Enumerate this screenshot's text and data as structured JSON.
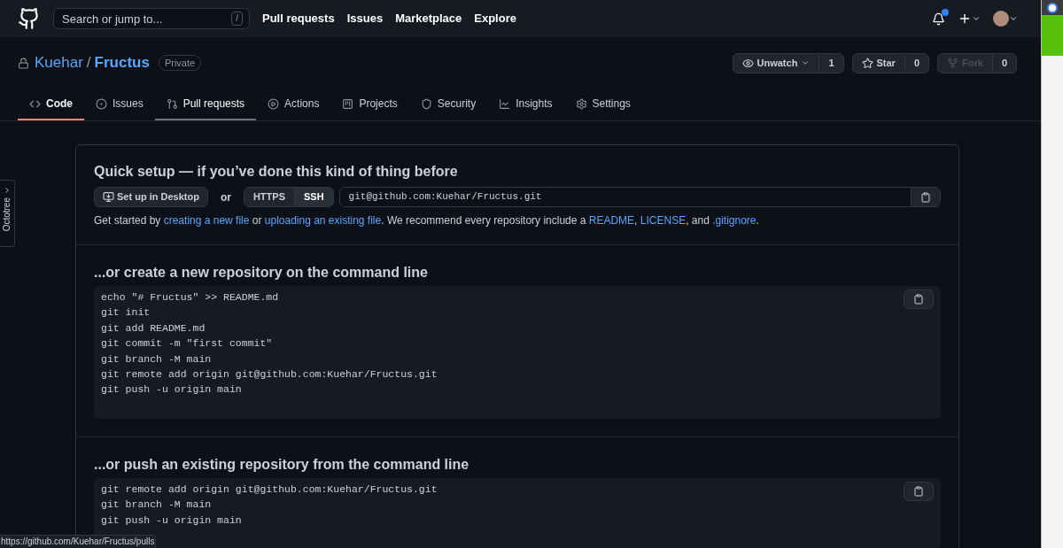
{
  "header": {
    "search": {
      "placeholder": "Search or jump to...",
      "shortcut": "/"
    },
    "nav": [
      "Pull requests",
      "Issues",
      "Marketplace",
      "Explore"
    ],
    "notification_unread": true
  },
  "repo": {
    "owner": "Kuehar",
    "separator": "/",
    "name": "Fructus",
    "visibility": "Private",
    "actions": [
      {
        "kind": "watch",
        "label": "Unwatch",
        "count": "1",
        "disabled": false
      },
      {
        "kind": "star",
        "label": "Star",
        "count": "0",
        "disabled": false
      },
      {
        "kind": "fork",
        "label": "Fork",
        "count": "0",
        "disabled": true
      }
    ]
  },
  "tabs": [
    {
      "kind": "code",
      "label": "Code",
      "selected": true,
      "hovered": false
    },
    {
      "kind": "issues",
      "label": "Issues",
      "selected": false,
      "hovered": false
    },
    {
      "kind": "pulls",
      "label": "Pull requests",
      "selected": false,
      "hovered": true
    },
    {
      "kind": "actions",
      "label": "Actions",
      "selected": false,
      "hovered": false
    },
    {
      "kind": "projects",
      "label": "Projects",
      "selected": false,
      "hovered": false
    },
    {
      "kind": "security",
      "label": "Security",
      "selected": false,
      "hovered": false
    },
    {
      "kind": "insights",
      "label": "Insights",
      "selected": false,
      "hovered": false
    },
    {
      "kind": "settings",
      "label": "Settings",
      "selected": false,
      "hovered": false
    }
  ],
  "sidebar_tab": {
    "label": "Octotree"
  },
  "quick_setup": {
    "title": "Quick setup — if you’ve done this kind of thing before",
    "desktop_button": "Set up in Desktop",
    "or": "or",
    "protocols": [
      {
        "label": "HTTPS",
        "selected": false
      },
      {
        "label": "SSH",
        "selected": true
      }
    ],
    "clone_url": "git@github.com:Kuehar/Fructus.git",
    "hint": [
      {
        "text": "Get started by ",
        "link": false
      },
      {
        "text": "creating a new file",
        "link": true
      },
      {
        "text": " or ",
        "link": false
      },
      {
        "text": "uploading an existing file",
        "link": true
      },
      {
        "text": ". We recommend every repository include a ",
        "link": false
      },
      {
        "text": "README",
        "link": true
      },
      {
        "text": ", ",
        "link": false
      },
      {
        "text": "LICENSE",
        "link": true
      },
      {
        "text": ", and ",
        "link": false
      },
      {
        "text": ".gitignore",
        "link": true
      },
      {
        "text": ".",
        "link": false
      }
    ]
  },
  "sections": [
    {
      "title": "...or create a new repository on the command line",
      "lines": [
        "echo \"# Fructus\" >> README.md",
        "git init",
        "git add README.md",
        "git commit -m \"first commit\"",
        "git branch -M main",
        "git remote add origin git@github.com:Kuehar/Fructus.git",
        "git push -u origin main"
      ]
    },
    {
      "title": "...or push an existing repository from the command line",
      "lines": [
        "git remote add origin git@github.com:Kuehar/Fructus.git",
        "git branch -M main",
        "git push -u origin main"
      ]
    }
  ],
  "status_bar": {
    "url": "https://github.com/Kuehar/Fructus/pulls"
  }
}
